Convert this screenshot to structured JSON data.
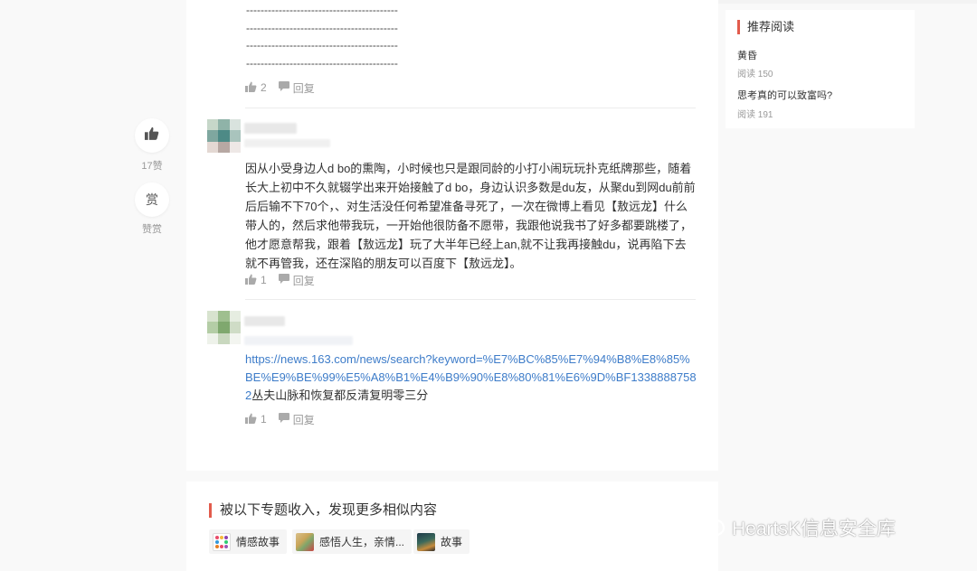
{
  "comment_top": {
    "dashes": [
      "------------------------------------------",
      "------------------------------------------",
      "------------------------------------------",
      "------------------------------------------"
    ],
    "likes": "2",
    "reply_label": "回复"
  },
  "float": {
    "likes_label": "17赞",
    "reward_glyph": "赏",
    "reward_label": "赞赏"
  },
  "comment_2": {
    "text": "因从小受身边人d bo的熏陶，小时候也只是跟同龄的小打小闹玩玩扑克纸牌那些，随着长大上初中不久就辍学出来开始接触了d bo，身边认识多数是du友，从聚du到网du前前后后输不下70个，、对生活没任何希望准备寻死了，一次在微博上看见【敖远龙】什么带人的，然后求他带我玩，一开始他很防备不愿带，我跟他说我书了好多都要跳楼了，他才愿意帮我，跟着【敖远龙】玩了大半年已经上an,就不让我再接触du，说再陷下去就不再管我，还在深陷的朋友可以百度下【敖远龙】。",
    "likes": "1",
    "reply_label": "回复"
  },
  "comment_3": {
    "link": "https://news.163.com/news/search?keyword=%E7%BC%85%E7%94%B8%E8%85%BE%E9%BE%99%E5%A8%B1%E4%B9%90%E8%80%81%E6%9D%BF13388887582",
    "text_after": "丛夫山脉和恢复都反清复明零三分",
    "likes": "1",
    "reply_label": "回复"
  },
  "sidebar": {
    "title": "推荐阅读",
    "items": [
      {
        "title": "黄昏",
        "meta": "阅读 150"
      },
      {
        "title": "思考真的可以致富吗?",
        "meta": "阅读 191"
      }
    ]
  },
  "topics": {
    "title": "被以下专题收入，发现更多相似内容",
    "tags": [
      {
        "label": "情感故事"
      },
      {
        "label": "感悟人生，亲情..."
      },
      {
        "label": "故事"
      }
    ]
  },
  "watermark": {
    "text": "HeartsK信息安全库"
  },
  "colors": {
    "accent": "#e25b4c",
    "link": "#3d7cc9"
  }
}
